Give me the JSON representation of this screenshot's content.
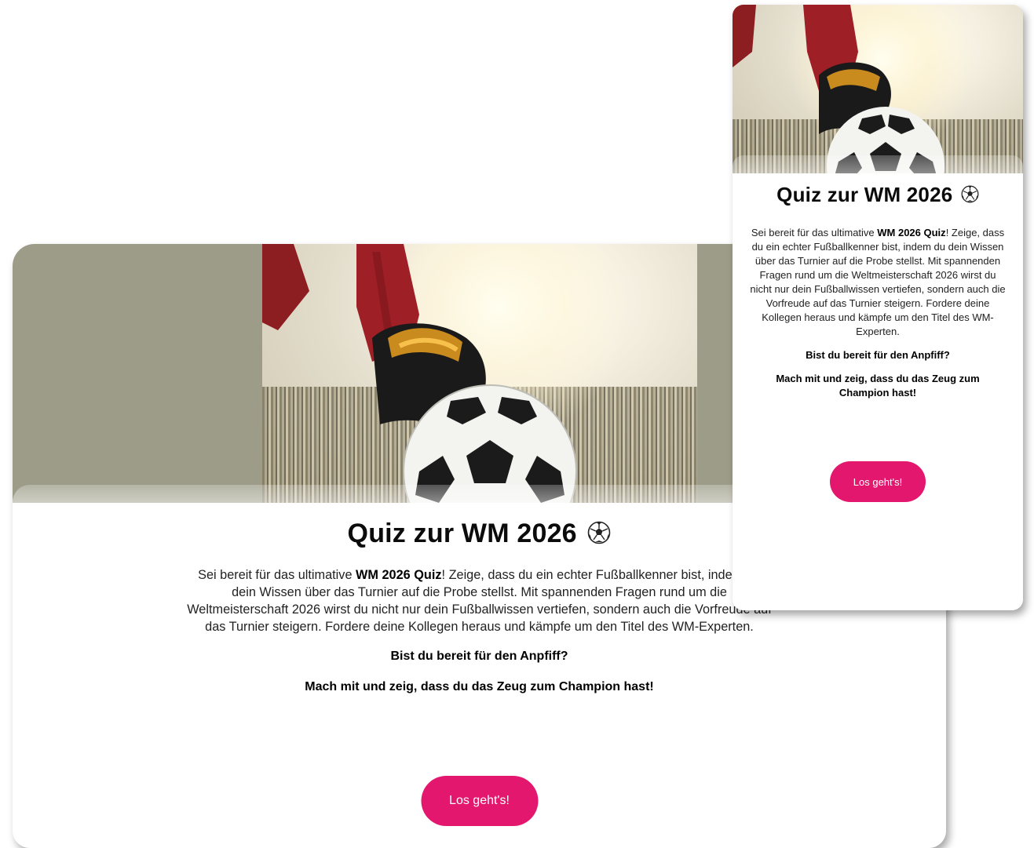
{
  "quiz": {
    "title": "Quiz zur WM 2026",
    "title_icon": "soccer-ball-icon",
    "intro": {
      "prefix": "Sei bereit für das ultimative ",
      "highlight": "WM 2026 Quiz",
      "suffix": "! Zeige, dass du ein echter Fußballkenner bist, indem du dein Wissen über das Turnier auf die Probe stellst. Mit spannenden Fragen rund um die Weltmeisterschaft 2026 wirst du nicht nur dein Fußballwissen vertiefen, sondern auch die Vorfreude auf das Turnier steigern. Fordere deine Kollegen heraus und kämpfe um den Titel des WM-Experten."
    },
    "question": "Bist du bereit für den Anpfiff?",
    "call_to_action": "Mach mit und zeig, dass du das Zeug zum Champion hast!",
    "start_button": "Los geht's!"
  },
  "colors": {
    "accent": "#e4176f",
    "hero_side": "#9c9c88",
    "text": "#111111"
  }
}
